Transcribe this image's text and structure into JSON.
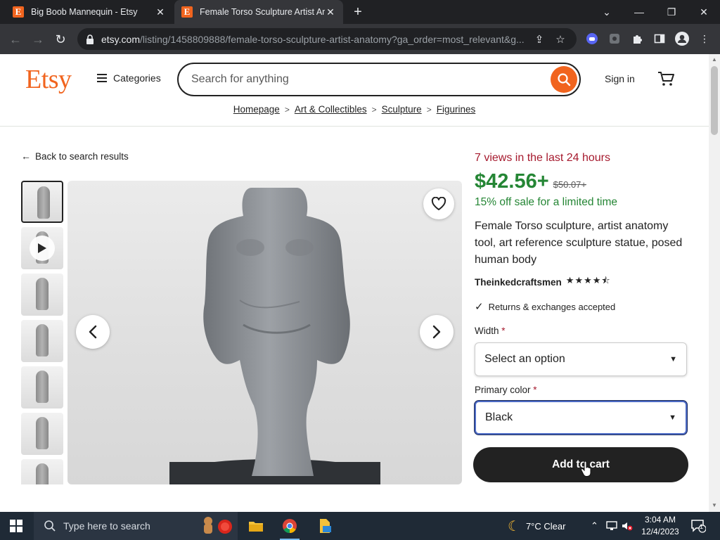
{
  "browser": {
    "tabs": [
      {
        "title": "Big Boob Mannequin - Etsy",
        "favicon": "E"
      },
      {
        "title": "Female Torso Sculpture Artist Ar",
        "favicon": "E"
      }
    ],
    "url_host": "etsy.com",
    "url_path": "/listing/1458809888/female-torso-sculpture-artist-anatomy?ga_order=most_relevant&g..."
  },
  "header": {
    "logo": "Etsy",
    "categories_label": "Categories",
    "search_placeholder": "Search for anything",
    "signin_label": "Sign in"
  },
  "breadcrumbs": [
    "Homepage",
    "Art & Collectibles",
    "Sculpture",
    "Figurines"
  ],
  "back_link": "Back to search results",
  "listing": {
    "views_text": "7 views in the last 24 hours",
    "price": "$42.56+",
    "original_price": "$50.07+",
    "sale_text": "15% off sale for a limited time",
    "title": "Female Torso sculpture, artist anatomy tool, art reference sculpture statue, posed human body",
    "shop_name": "Theinkedcraftsmen",
    "rating": 4.5,
    "stars": "★★★★⯪",
    "returns_text": "Returns & exchanges accepted",
    "width_label": "Width",
    "width_value": "Select an option",
    "color_label": "Primary color",
    "color_value": "Black",
    "required_mark": "*",
    "add_to_cart": "Add to cart"
  },
  "thumbnails_count": 7,
  "taskbar": {
    "search_placeholder": "Type here to search",
    "weather": "7°C  Clear",
    "time": "3:04 AM",
    "date": "12/4/2023",
    "notification_count": "1"
  },
  "colors": {
    "etsy_orange": "#f1641e",
    "price_green": "#258635",
    "views_red": "#a61a2e",
    "focus_blue": "#4d6bc6"
  }
}
